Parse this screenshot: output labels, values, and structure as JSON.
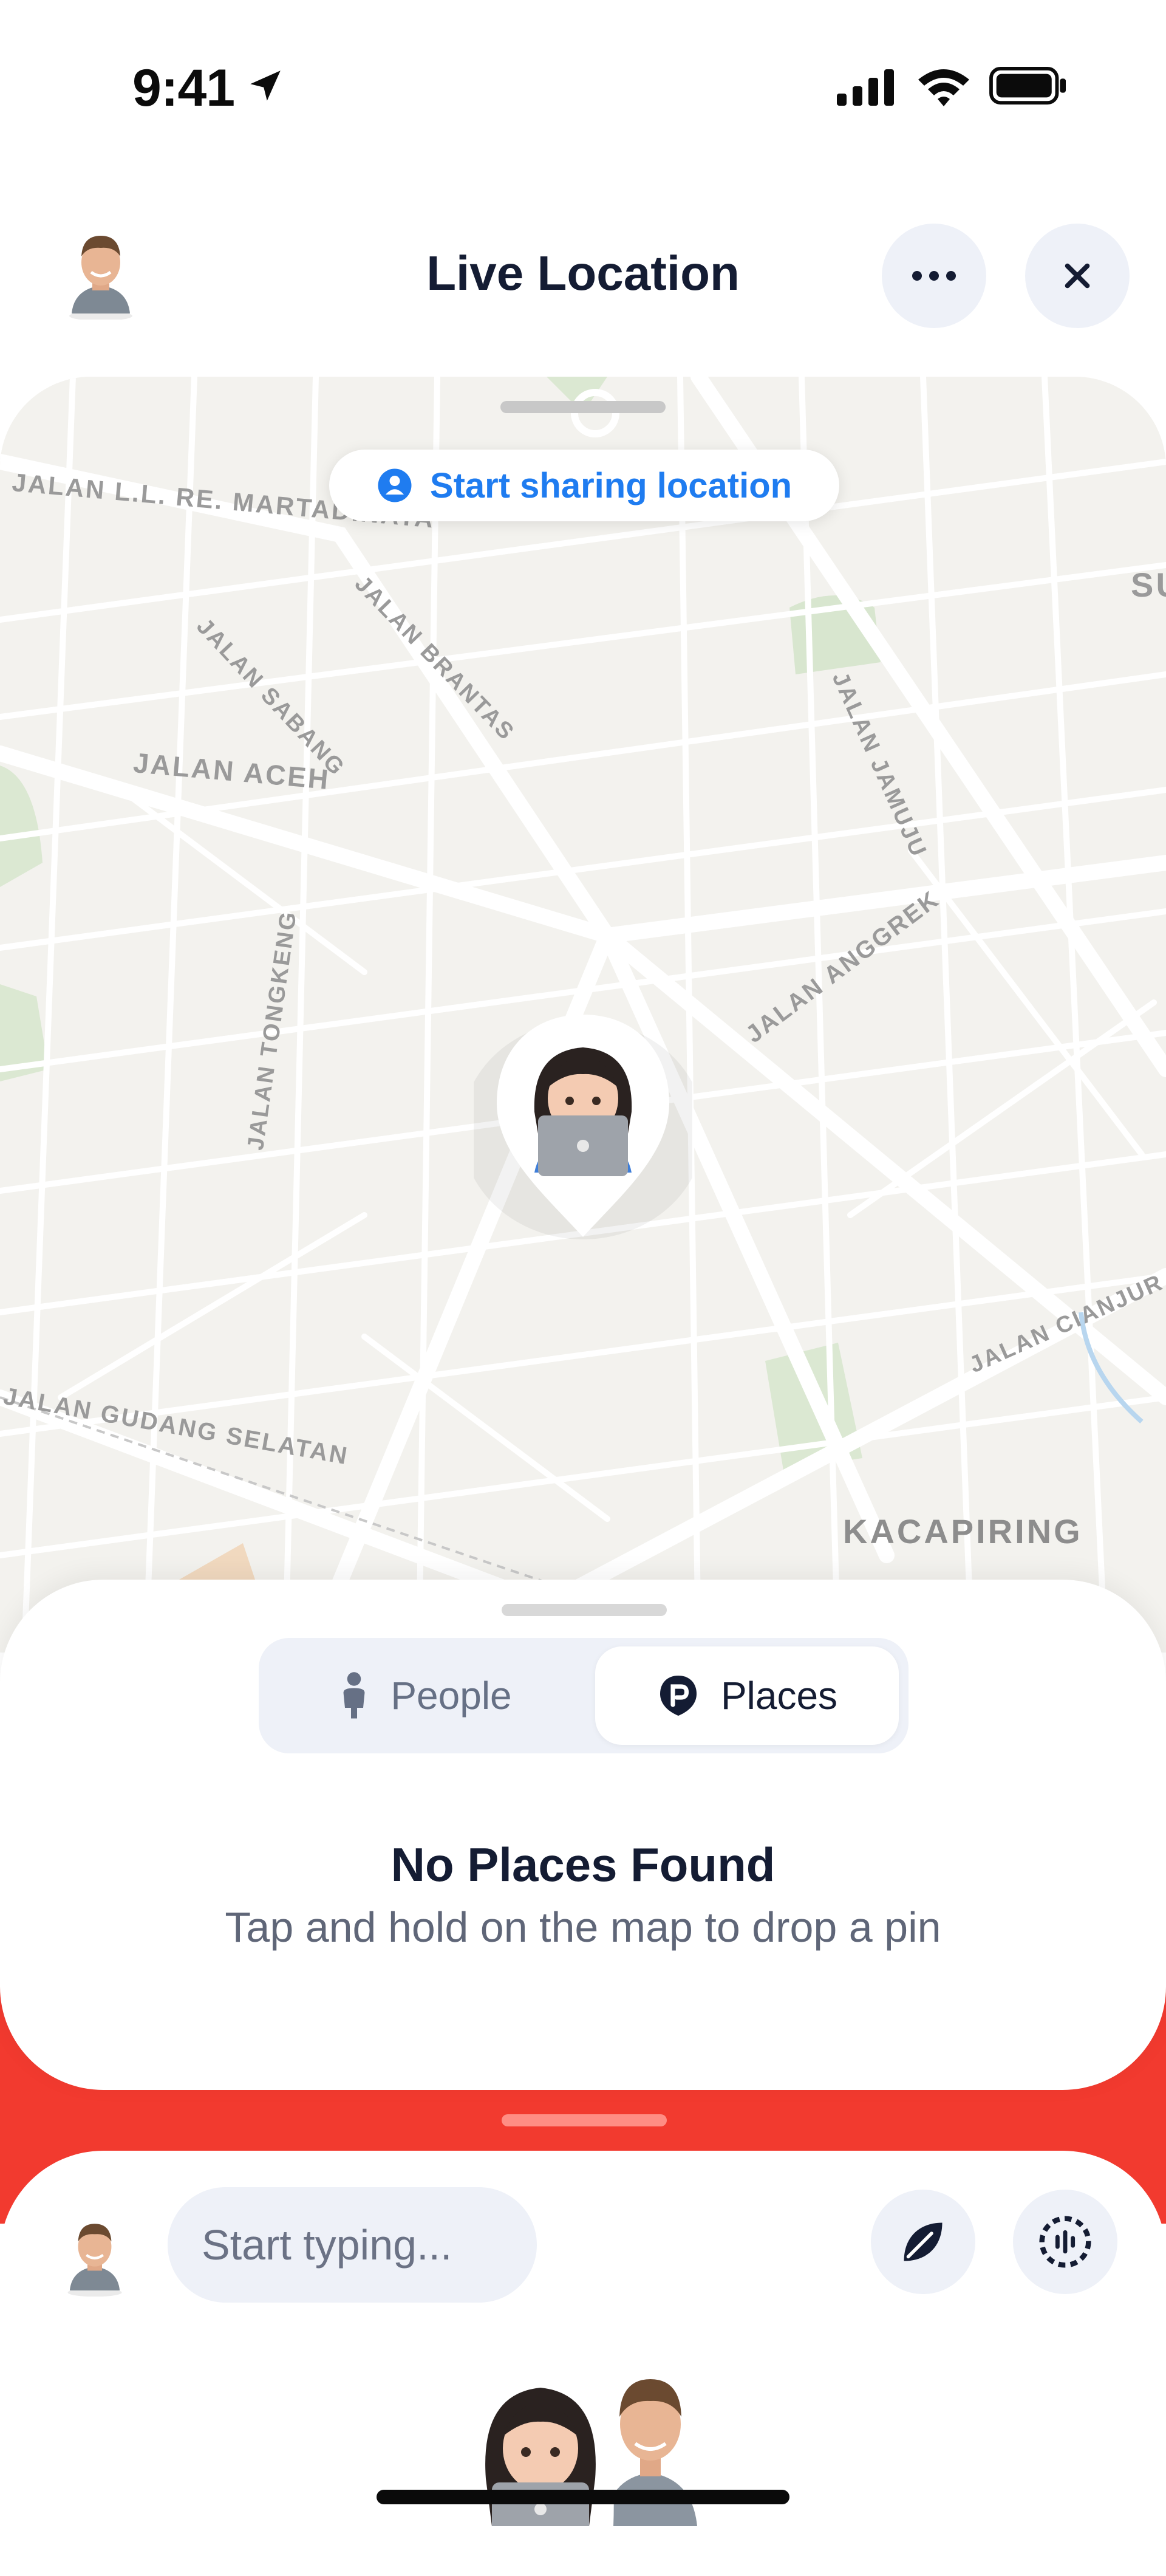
{
  "status_bar": {
    "time": "9:41"
  },
  "header": {
    "title": "Live Location"
  },
  "map": {
    "share_button_label": "Start sharing location",
    "streets": {
      "re_martadinata": "JALAN L.L. RE. MARTADINATA",
      "sabang": "JALAN SABANG",
      "brantas": "JALAN BRANTAS",
      "aceh": "JALAN ACEH",
      "jamuju": "JALAN JAMUJU",
      "anggrek": "JALAN ANGGREK",
      "tongkeng": "JALAN TONGKENG",
      "gudang_selatan": "JALAN GUDANG SELATAN",
      "cianjur": "JALAN CIANJUR"
    },
    "district": "KACAPIRING",
    "edge_label_su": "SU"
  },
  "sheet": {
    "tabs": [
      {
        "label": "People",
        "selected": false
      },
      {
        "label": "Places",
        "selected": true
      }
    ],
    "empty_title": "No Places Found",
    "empty_subtitle": "Tap and hold on the map to drop a pin"
  },
  "composer": {
    "placeholder": "Start typing..."
  },
  "colors": {
    "accent_blue": "#1f7cf0",
    "brand_red": "#f23a2f",
    "dark_text": "#141c33"
  },
  "icons": [
    "location-arrow-icon",
    "signal-icon",
    "wifi-icon",
    "battery-icon",
    "more-icon",
    "close-icon",
    "person-pin-icon",
    "person-icon",
    "place-icon",
    "leaf-icon",
    "voice-icon"
  ]
}
